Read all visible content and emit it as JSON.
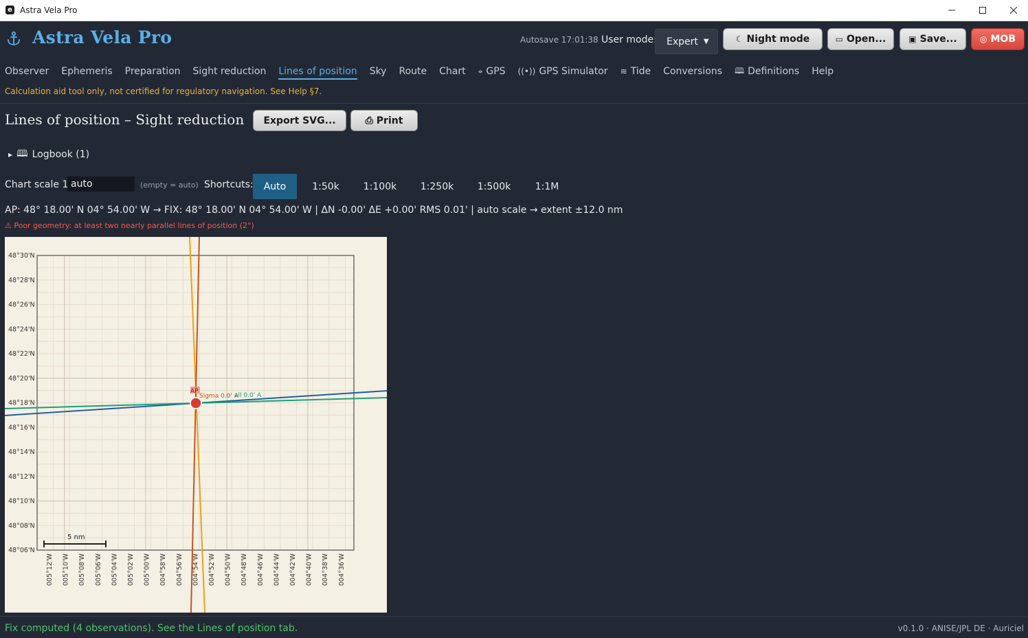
{
  "window": {
    "title": "Astra Vela Pro",
    "app_icon_letter": "e"
  },
  "header": {
    "app_name": "Astra Vela Pro",
    "autosave": "Autosave 17:01:38",
    "user_mode_label": "User mode:",
    "user_mode_value": "Expert",
    "buttons": {
      "night_mode": "Night mode",
      "open": "Open...",
      "save": "Save...",
      "mob": "MOB"
    }
  },
  "tabs": [
    "Observer",
    "Ephemeris",
    "Preparation",
    "Sight reduction",
    "Lines of position",
    "Sky",
    "Route",
    "Chart",
    "GPS",
    "GPS Simulator",
    "Tide",
    "Conversions",
    "Definitions",
    "Help"
  ],
  "active_tab": "Lines of position",
  "disclaimer": "Calculation aid tool only, not certified for regulatory navigation. See Help §7.",
  "page": {
    "title": "Lines of position – Sight reduction",
    "export_button": "Export SVG...",
    "print_button": "Print",
    "logbook": "Logbook (1)",
    "scale_label": "Chart scale 1:",
    "scale_value": "auto",
    "scale_hint": "(empty = auto)",
    "shortcuts_label": "Shortcuts:",
    "shortcuts": [
      "Auto",
      "1:50k",
      "1:100k",
      "1:250k",
      "1:500k",
      "1:1M"
    ],
    "active_shortcut": "Auto",
    "summary": "AP: 48° 18.00' N 04° 54.00' W  →  FIX: 48° 18.00' N 04° 54.00' W   |   ΔN -0.00'  ΔE +0.00'  RMS 0.01'   |   auto scale  →  extent ±12.0 nm",
    "warning": "⚠ Poor geometry: at least two nearly parallel lines of position (2°)"
  },
  "plot": {
    "lat_labels": [
      "48°30'N",
      "48°28'N",
      "48°26'N",
      "48°24'N",
      "48°22'N",
      "48°20'N",
      "48°18'N",
      "48°16'N",
      "48°14'N",
      "48°12'N",
      "48°10'N",
      "48°08'N",
      "48°06'N"
    ],
    "lon_labels": [
      "005°12'W",
      "005°10'W",
      "005°08'W",
      "005°06'W",
      "005°04'W",
      "005°02'W",
      "005°00'W",
      "004°58'W",
      "004°56'W",
      "004°54'W",
      "004°52'W",
      "004°50'W",
      "004°48'W",
      "004°46'W",
      "004°44'W",
      "004°42'W",
      "004°40'W",
      "004°38'W",
      "004°36'W"
    ],
    "scale_bar": "5 nm",
    "ap_label": "AP",
    "lop_label": "Sigma 0.0' A",
    "lop_label_2": "all 0.0' A",
    "colors": {
      "background": "#f5f0e4",
      "lop_orange": "#e8a21a",
      "lop_rust": "#c8531c",
      "lop_blue": "#1f5fa6",
      "lop_green": "#1aa078",
      "fix": "#d93a2f"
    }
  },
  "status": {
    "message": "Fix computed (4 observations). See the Lines of position tab.",
    "version": "v0.1.0 · ANISE/JPL DE · Auriciel"
  }
}
